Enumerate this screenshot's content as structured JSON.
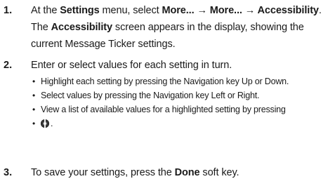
{
  "steps": [
    {
      "number": "1.",
      "parts": [
        {
          "t": "At the ",
          "b": false
        },
        {
          "t": "Settings",
          "b": true
        },
        {
          "t": " menu, select ",
          "b": false
        },
        {
          "t": "More... → More... → Accessibility",
          "b": true
        },
        {
          "t": ". The ",
          "b": false
        },
        {
          "t": "Accessibility",
          "b": true
        },
        {
          "t": " screen appears in the display, showing the current Message Ticker settings.",
          "b": false
        }
      ]
    },
    {
      "number": "2.",
      "text": "Enter or select values for each setting in turn.",
      "bullets": [
        "Highlight each setting by pressing the Navigation key Up or Down.",
        "Select values by pressing the Navigation key Left or Right.",
        "View a list of available values for a highlighted setting by pressing"
      ],
      "bullet_end": "."
    },
    {
      "number": "3.",
      "text_before": "To save your settings, press the ",
      "bold": "Done",
      "text_after": " soft key."
    }
  ],
  "icons": {
    "ok_key": "navigation-ok-key-icon"
  }
}
